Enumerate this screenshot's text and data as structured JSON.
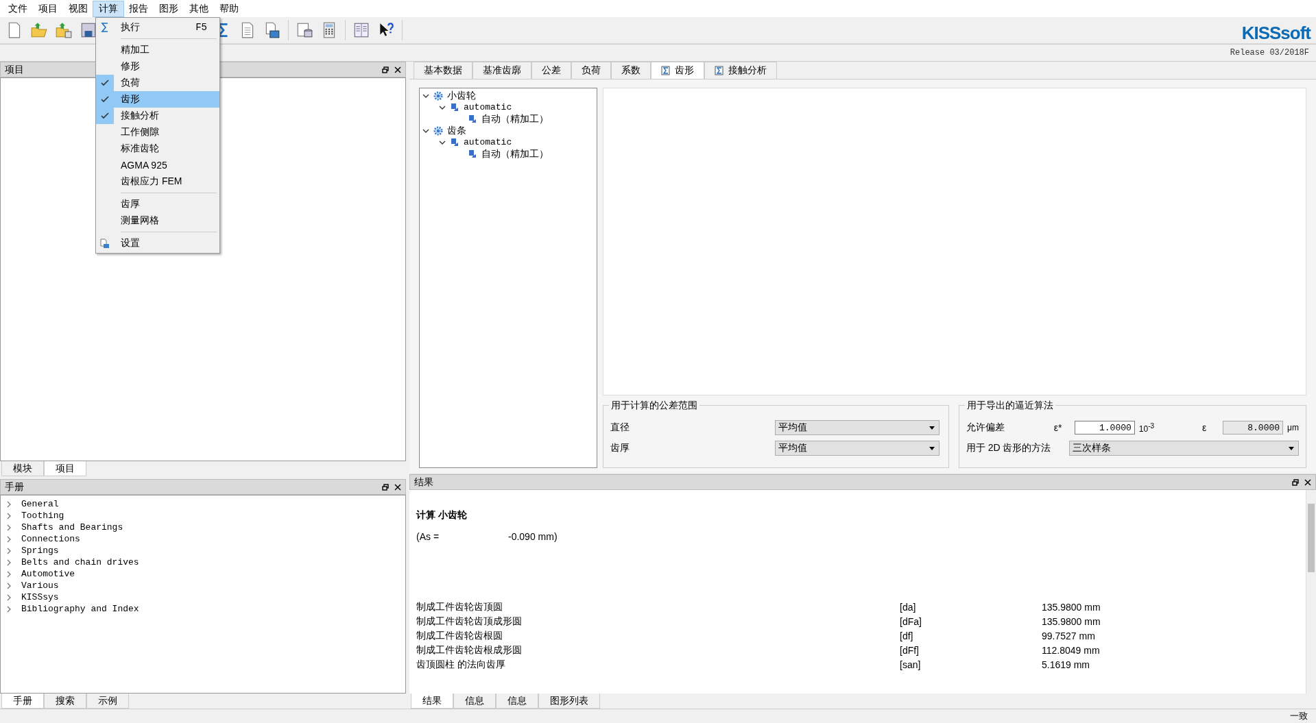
{
  "menu": [
    {
      "label": "文件",
      "selected": false
    },
    {
      "label": "项目",
      "selected": false
    },
    {
      "label": "视图",
      "selected": false
    },
    {
      "label": "计算",
      "selected": true
    },
    {
      "label": "报告",
      "selected": false
    },
    {
      "label": "图形",
      "selected": false
    },
    {
      "label": "其他",
      "selected": false
    },
    {
      "label": "帮助",
      "selected": false
    }
  ],
  "dropdown": {
    "groups": [
      [
        {
          "kind": "execute",
          "label": "执行",
          "shortcut": "F5",
          "checked": false,
          "selected": false
        }
      ],
      [
        {
          "label": "精加工",
          "checked": false,
          "selected": false
        },
        {
          "label": "修形",
          "checked": false,
          "selected": false
        },
        {
          "label": "负荷",
          "checked": true,
          "selected": false
        },
        {
          "label": "齿形",
          "checked": true,
          "selected": true
        },
        {
          "label": "接触分析",
          "checked": true,
          "selected": false
        },
        {
          "label": "工作侧隙",
          "checked": false,
          "selected": false
        },
        {
          "label": "标准齿轮",
          "checked": false,
          "selected": false
        },
        {
          "label": "AGMA 925",
          "checked": false,
          "selected": false
        },
        {
          "label": "齿根应力 FEM",
          "checked": false,
          "selected": false
        }
      ],
      [
        {
          "label": "齿厚",
          "checked": false,
          "selected": false
        },
        {
          "label": "测量网格",
          "checked": false,
          "selected": false
        }
      ],
      [
        {
          "kind": "settings",
          "label": "设置",
          "checked": false,
          "selected": false
        }
      ]
    ]
  },
  "logo": "KISSsoft",
  "release": "Release 03/2018F",
  "project_panel": {
    "title": "项目",
    "tabs": [
      {
        "label": "模块",
        "selected": false
      },
      {
        "label": "项目",
        "selected": true
      }
    ]
  },
  "manual_panel": {
    "title": "手册",
    "items": [
      "General",
      "Toothing",
      "Shafts and Bearings",
      "Connections",
      "Springs",
      "Belts and chain drives",
      "Automotive",
      "Various",
      "KISSsys",
      "Bibliography and Index"
    ],
    "tabs": [
      {
        "label": "手册",
        "selected": true
      },
      {
        "label": "搜索",
        "selected": false
      },
      {
        "label": "示例",
        "selected": false
      }
    ]
  },
  "tabs": [
    {
      "label": "基本数据",
      "kind": "plain",
      "selected": false
    },
    {
      "label": "基准齿廓",
      "kind": "plain",
      "selected": false
    },
    {
      "label": "公差",
      "kind": "plain",
      "selected": false
    },
    {
      "label": "负荷",
      "kind": "plain",
      "selected": false
    },
    {
      "label": "系数",
      "kind": "plain",
      "selected": false
    },
    {
      "label": "齿形",
      "kind": "calc",
      "selected": true
    },
    {
      "label": "接触分析",
      "kind": "calc",
      "selected": false
    }
  ],
  "tree": [
    {
      "label": "小齿轮",
      "kind": "gear",
      "expanded": true,
      "children": [
        {
          "label": "automatic",
          "kind": "tool",
          "expanded": true,
          "children": [
            {
              "label": "自动（精加工）",
              "kind": "tool"
            }
          ]
        }
      ]
    },
    {
      "label": "齿条",
      "kind": "gear",
      "expanded": true,
      "children": [
        {
          "label": "automatic",
          "kind": "tool",
          "expanded": true,
          "children": [
            {
              "label": "自动（精加工）",
              "kind": "tool"
            }
          ]
        }
      ]
    }
  ],
  "tolerance": {
    "title": "用于计算的公差范围",
    "rows": [
      {
        "label": "直径",
        "value": "平均值"
      },
      {
        "label": "齿厚",
        "value": "平均值"
      }
    ]
  },
  "approx": {
    "title": "用于导出的逼近算法",
    "label": "允许偏差",
    "eps_star": "ε*",
    "value": "1.0000",
    "unit": "10$^{-3}$",
    "eps": "ε",
    "value2": "8.0000",
    "value2_disabled": true,
    "unit2": "μm",
    "method_label": "用于 2D 齿形的方法",
    "method": "三次样条"
  },
  "results": {
    "title": "结果",
    "heading": "计算 小齿轮",
    "as_label": "(As =",
    "as_value": "-0.090 mm)",
    "rows": [
      {
        "label": "制成工件齿轮齿顶圆",
        "symbol": "[da]",
        "value": "135.9800 mm"
      },
      {
        "label": "制成工件齿轮齿顶成形圆",
        "symbol": "[dFa]",
        "value": "135.9800 mm"
      },
      {
        "label": "制成工件齿轮齿根圆",
        "symbol": "[df]",
        "value": "99.7527 mm"
      },
      {
        "label": "制成工件齿轮齿根成形圆",
        "symbol": "[dFf]",
        "value": "112.8049 mm"
      },
      {
        "label": "齿顶圆柱 的法向齿厚",
        "symbol": "[san]",
        "value": "5.1619 mm"
      }
    ],
    "tabs": [
      {
        "label": "结果",
        "selected": true
      },
      {
        "label": "信息",
        "selected": false
      },
      {
        "label": "信息",
        "selected": false
      },
      {
        "label": "图形列表",
        "selected": false
      }
    ]
  },
  "status": "一致"
}
